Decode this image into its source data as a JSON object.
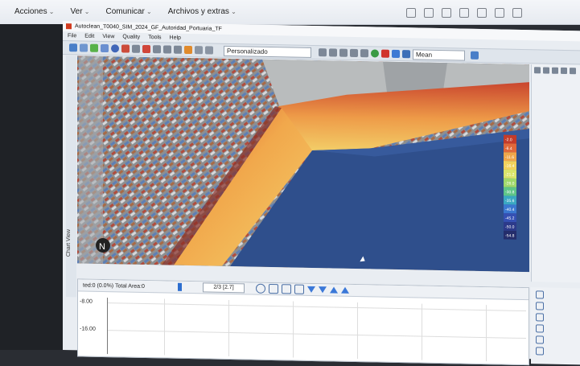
{
  "outer_menu": [
    "Acciones",
    "Ver",
    "Comunicar",
    "Archivos y extras"
  ],
  "app": {
    "title": "Autoclean_T0040_SIM_2024_GF_Autoridad_Portuaria_TF",
    "menu": [
      "File",
      "Edit",
      "View",
      "Quality",
      "Tools",
      "Help"
    ],
    "combo_value": "Personalizado",
    "mean_value": "Mean"
  },
  "legend": {
    "labels": [
      "-2.0",
      "-6.4",
      "-11.6",
      "-16.4",
      "-21.2",
      "-26.0",
      "-30.8",
      "-35.6",
      "-40.4",
      "-45.2",
      "-50.0",
      "-54.8"
    ],
    "colors": [
      "#c33b2a",
      "#e0683a",
      "#efa64a",
      "#f2d25c",
      "#d9e46a",
      "#9fd86a",
      "#5ec587",
      "#3aa8c2",
      "#3b78d0",
      "#3550b3",
      "#2c3a8a",
      "#242d6b"
    ]
  },
  "chart_tab_label": "Chart View",
  "bottom": {
    "status": "ted:0 (0.0%) Total Area:0",
    "page": "2/3 [2.7]",
    "y_ticks": [
      "-8.00",
      "-16.00"
    ]
  }
}
